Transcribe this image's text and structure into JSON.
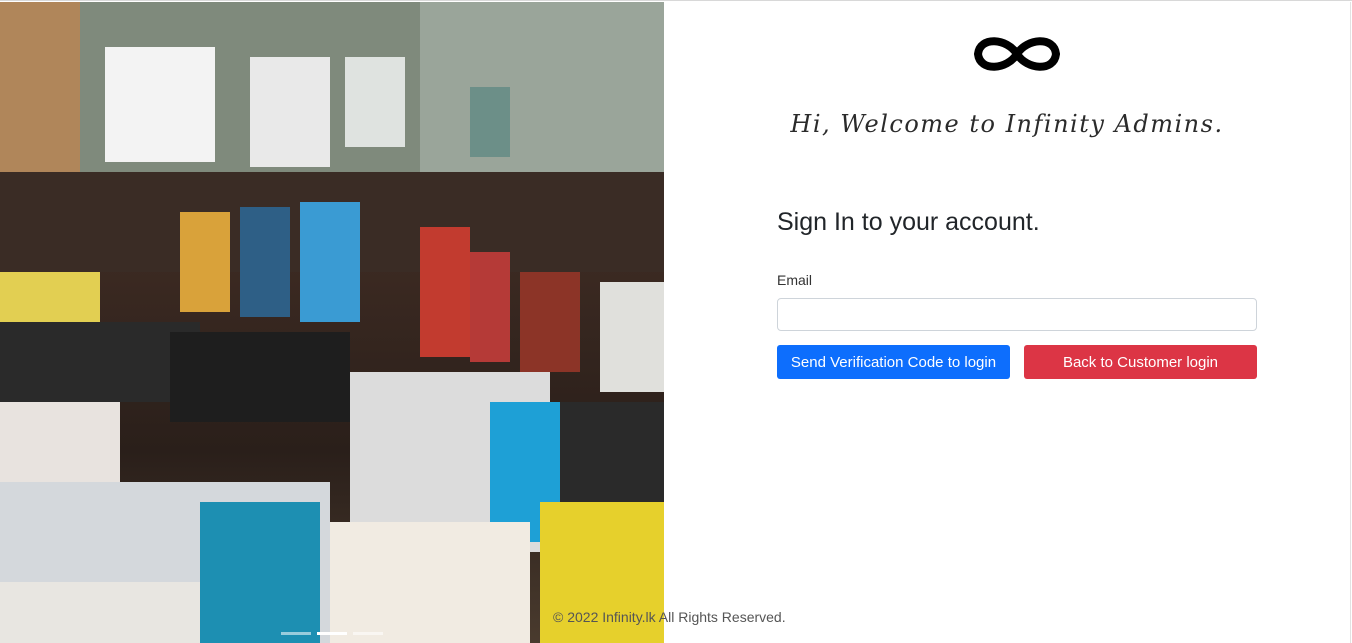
{
  "welcome": "Hi, Welcome to Infinity Admins.",
  "signin": {
    "title": "Sign In to your account.",
    "email_label": "Email",
    "email_value": "",
    "email_placeholder": ""
  },
  "buttons": {
    "send_code": "Send Verification Code to login",
    "back_customer": "Back to Customer login"
  },
  "footer": "© 2022 Infinity.lk All Rights Reserved.",
  "carousel": {
    "slides": 3,
    "active_index": 1
  },
  "icons": {
    "logo": "infinity-logo-icon"
  },
  "colors": {
    "primary": "#0d6efd",
    "danger": "#dc3545",
    "text": "#212529"
  }
}
